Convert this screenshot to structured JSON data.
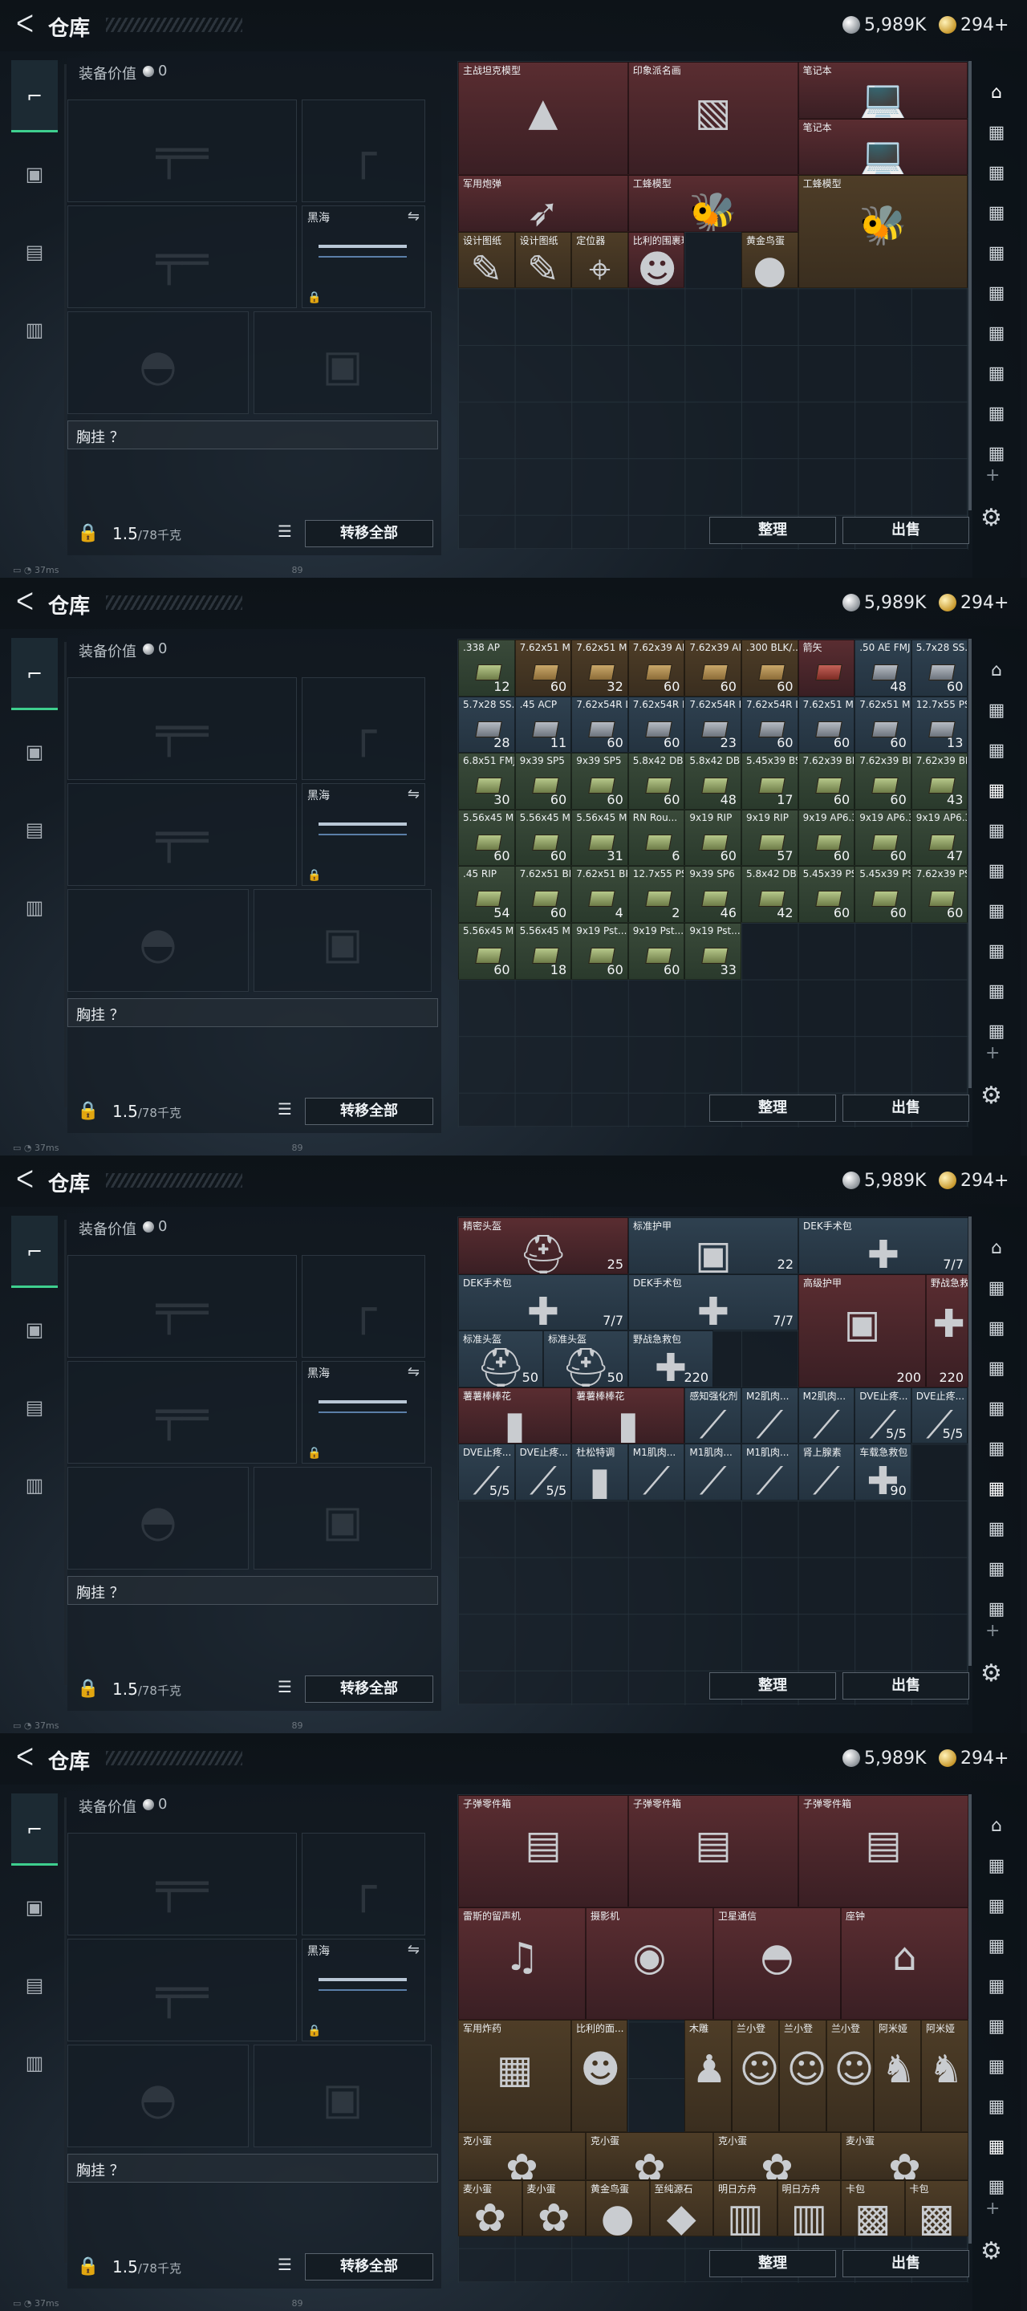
{
  "title": "仓库",
  "silver": "5,989K",
  "gold": "294+",
  "equip_label": "装备价值",
  "equip_value": "0",
  "blackhawk": "黑海",
  "chest_label": "胸挂 ？",
  "weight": "1.5",
  "weight_cap": "/78千克",
  "transfer_all": "转移全部",
  "sort": "整理",
  "sell": "出售",
  "status": "37ms",
  "status_num": "89",
  "icons": {
    "back": "back-arrow-icon",
    "pistol": "pistol-icon",
    "vest": "vest-icon",
    "backpack": "backpack-icon",
    "case": "case-icon",
    "settings": "gear-icon",
    "add": "plus-icon",
    "list": "list-icon",
    "lock": "lock-icon"
  },
  "panel1_items": [
    {
      "label": "主战坦克模型",
      "color": "red"
    },
    {
      "label": "印象派名画",
      "color": "red"
    },
    {
      "label": "笔记本",
      "color": "red"
    },
    {
      "label": "笔记本",
      "color": "red"
    },
    {
      "label": "军用炮弹",
      "color": "red"
    },
    {
      "label": "工蜂模型",
      "color": "red"
    },
    {
      "label": "工蜂模型",
      "color": "gold"
    },
    {
      "label": "设计图纸",
      "color": "gold"
    },
    {
      "label": "设计图纸",
      "color": "gold"
    },
    {
      "label": "定位器",
      "color": "gold"
    },
    {
      "label": "比利的围裹玩",
      "color": "red"
    },
    {
      "label": "黄金鸟蛋",
      "color": "gold"
    }
  ],
  "panel2_rows": [
    [
      {
        "n": ".338 AP",
        "c": "12",
        "k": "grn"
      },
      {
        "n": "7.62x51 M6...",
        "c": "60",
        "k": "gold"
      },
      {
        "n": "7.62x51 M6...",
        "c": "32",
        "k": "gold"
      },
      {
        "n": "7.62x39 AP",
        "c": "60",
        "k": "gold"
      },
      {
        "n": "7.62x39 AP",
        "c": "60",
        "k": "gold"
      },
      {
        "n": ".300 BLK/...",
        "c": "60",
        "k": "gold"
      },
      {
        "n": "箭矢",
        "c": "",
        "k": "red"
      },
      {
        "n": ".50 AE FMJ",
        "c": "48",
        "k": "blu"
      },
      {
        "n": "5.7x28 SS...",
        "c": "60",
        "k": "blu"
      }
    ],
    [
      {
        "n": "5.7x28 SS...",
        "c": "28",
        "k": "blu"
      },
      {
        "n": ".45 ACP",
        "c": "11",
        "k": "blu"
      },
      {
        "n": "7.62x54R LPS",
        "c": "60",
        "k": "blu"
      },
      {
        "n": "7.62x54R LPS",
        "c": "60",
        "k": "blu"
      },
      {
        "n": "7.62x54R LPS",
        "c": "23",
        "k": "blu"
      },
      {
        "n": "7.62x54R LPS",
        "c": "60",
        "k": "blu"
      },
      {
        "n": "7.62x51 M...",
        "c": "60",
        "k": "blu"
      },
      {
        "n": "7.62x51 M...",
        "c": "60",
        "k": "blu"
      },
      {
        "n": "12.7x55 PS12...",
        "c": "13",
        "k": "blu"
      }
    ],
    [
      {
        "n": "6.8x51 FMJ",
        "c": "30",
        "k": "grn"
      },
      {
        "n": "9x39 SP5",
        "c": "60",
        "k": "grn"
      },
      {
        "n": "9x39 SP5",
        "c": "60",
        "k": "grn"
      },
      {
        "n": "5.8x42 DBP...",
        "c": "60",
        "k": "grn"
      },
      {
        "n": "5.8x42 DBP...",
        "c": "48",
        "k": "grn"
      },
      {
        "n": "5.45x39 BS",
        "c": "17",
        "k": "grn"
      },
      {
        "n": "7.62x39 BP",
        "c": "60",
        "k": "grn"
      },
      {
        "n": "7.62x39 BP",
        "c": "60",
        "k": "grn"
      },
      {
        "n": "7.62x39 BP",
        "c": "43",
        "k": "grn"
      }
    ],
    [
      {
        "n": "5.56x45 M855A1",
        "c": "60",
        "k": "grn"
      },
      {
        "n": "5.56x45 M855A1",
        "c": "60",
        "k": "grn"
      },
      {
        "n": "5.56x45 M855A1",
        "c": "31",
        "k": "grn"
      },
      {
        "n": "RN Rou...",
        "c": "6",
        "k": "grn"
      },
      {
        "n": "9x19 RIP",
        "c": "60",
        "k": "grn"
      },
      {
        "n": "9x19 RIP",
        "c": "57",
        "k": "grn"
      },
      {
        "n": "9x19 AP6.3",
        "c": "60",
        "k": "grn"
      },
      {
        "n": "9x19 AP6.3",
        "c": "60",
        "k": "grn"
      },
      {
        "n": "9x19 AP6.3",
        "c": "47",
        "k": "grn"
      }
    ],
    [
      {
        "n": ".45 RIP",
        "c": "54",
        "k": "grn"
      },
      {
        "n": "7.62x51 BPZ",
        "c": "60",
        "k": "grn"
      },
      {
        "n": "7.62x51 BPZ",
        "c": "4",
        "k": "grn"
      },
      {
        "n": "12.7x55 PS12",
        "c": "2",
        "k": "grn"
      },
      {
        "n": "9x39 SP6",
        "c": "46",
        "k": "grn"
      },
      {
        "n": "5.8x42 DBP10",
        "c": "42",
        "k": "grn"
      },
      {
        "n": "5.45x39 PS",
        "c": "60",
        "k": "grn"
      },
      {
        "n": "5.45x39 PS",
        "c": "60",
        "k": "grn"
      },
      {
        "n": "7.62x39 PS",
        "c": "60",
        "k": "grn"
      }
    ],
    [
      {
        "n": "5.56x45 M855",
        "c": "60",
        "k": "grn"
      },
      {
        "n": "5.56x45 M855",
        "c": "18",
        "k": "grn"
      },
      {
        "n": "9x19 Pst...",
        "c": "60",
        "k": "grn"
      },
      {
        "n": "9x19 Pst...",
        "c": "60",
        "k": "grn"
      },
      {
        "n": "9x19 Pst...",
        "c": "33",
        "k": "grn"
      }
    ]
  ],
  "panel3_items": [
    {
      "label": "精密头盔",
      "count": "25",
      "color": "red"
    },
    {
      "label": "标准护甲",
      "count": "22",
      "color": "blu"
    },
    {
      "label": "DEK手术包",
      "count": "7/7",
      "color": "blu"
    },
    {
      "label": "DEK手术包",
      "count": "7/7",
      "color": "blu"
    },
    {
      "label": "DEK手术包",
      "count": "7/7",
      "color": "blu"
    },
    {
      "label": "高级护甲",
      "count": "200",
      "color": "red"
    },
    {
      "label": "野战急救包",
      "count": "220",
      "color": "red"
    },
    {
      "label": "标准头盔",
      "count": "50",
      "color": "blu"
    },
    {
      "label": "标准头盔",
      "count": "50",
      "color": "blu"
    },
    {
      "label": "野战急救包",
      "count": "220",
      "color": "blu"
    },
    {
      "label": "薯薯棒棒花",
      "count": "",
      "color": "red"
    },
    {
      "label": "薯薯棒棒花",
      "count": "",
      "color": "red"
    },
    {
      "label": "感知强化剂",
      "count": "",
      "color": "blu"
    },
    {
      "label": "M2肌肉...",
      "count": "",
      "color": "blu"
    },
    {
      "label": "M2肌肉...",
      "count": "",
      "color": "blu"
    },
    {
      "label": "DVE止疼...",
      "count": "5/5",
      "color": "blu"
    },
    {
      "label": "DVE止疼...",
      "count": "5/5",
      "color": "blu"
    },
    {
      "label": "DVE止疼...",
      "count": "5/5",
      "color": "blu"
    },
    {
      "label": "DVE止疼...",
      "count": "5/5",
      "color": "blu"
    },
    {
      "label": "杜松特调",
      "count": "",
      "color": "blu"
    },
    {
      "label": "M1肌肉...",
      "count": "",
      "color": "blu"
    },
    {
      "label": "M1肌肉...",
      "count": "",
      "color": "blu"
    },
    {
      "label": "M1肌肉...",
      "count": "",
      "color": "blu"
    },
    {
      "label": "肾上腺素",
      "count": "",
      "color": "blu"
    },
    {
      "label": "车载急救包",
      "count": "90",
      "color": "blu"
    }
  ],
  "panel4_items": [
    {
      "label": "子弹零件箱",
      "color": "red"
    },
    {
      "label": "子弹零件箱",
      "color": "red"
    },
    {
      "label": "子弹零件箱",
      "color": "red"
    },
    {
      "label": "雷斯的留声机",
      "color": "red"
    },
    {
      "label": "摄影机",
      "color": "red"
    },
    {
      "label": "卫星通信",
      "color": "red"
    },
    {
      "label": "座钟",
      "color": "red"
    },
    {
      "label": "军用炸药",
      "color": "gold"
    },
    {
      "label": "比利的面...",
      "color": "gold"
    },
    {
      "label": "木雕",
      "color": "gold"
    },
    {
      "label": "兰小登",
      "color": "gold"
    },
    {
      "label": "兰小登",
      "color": "gold"
    },
    {
      "label": "兰小登",
      "color": "gold"
    },
    {
      "label": "阿米娅",
      "color": "gold"
    },
    {
      "label": "阿米娅",
      "color": "gold"
    },
    {
      "label": "克小蛋",
      "color": "gold"
    },
    {
      "label": "克小蛋",
      "color": "gold"
    },
    {
      "label": "克小蛋",
      "color": "gold"
    },
    {
      "label": "麦小蛋",
      "color": "gold"
    },
    {
      "label": "麦小蛋",
      "color": "gold"
    },
    {
      "label": "麦小蛋",
      "color": "gold"
    },
    {
      "label": "黄金鸟蛋",
      "color": "gold"
    },
    {
      "label": "至纯源石",
      "color": "gold"
    },
    {
      "label": "明日方舟",
      "color": "gold"
    },
    {
      "label": "明日方舟",
      "color": "gold"
    },
    {
      "label": "卡包",
      "color": "gold"
    },
    {
      "label": "卡包",
      "color": "gold"
    }
  ]
}
